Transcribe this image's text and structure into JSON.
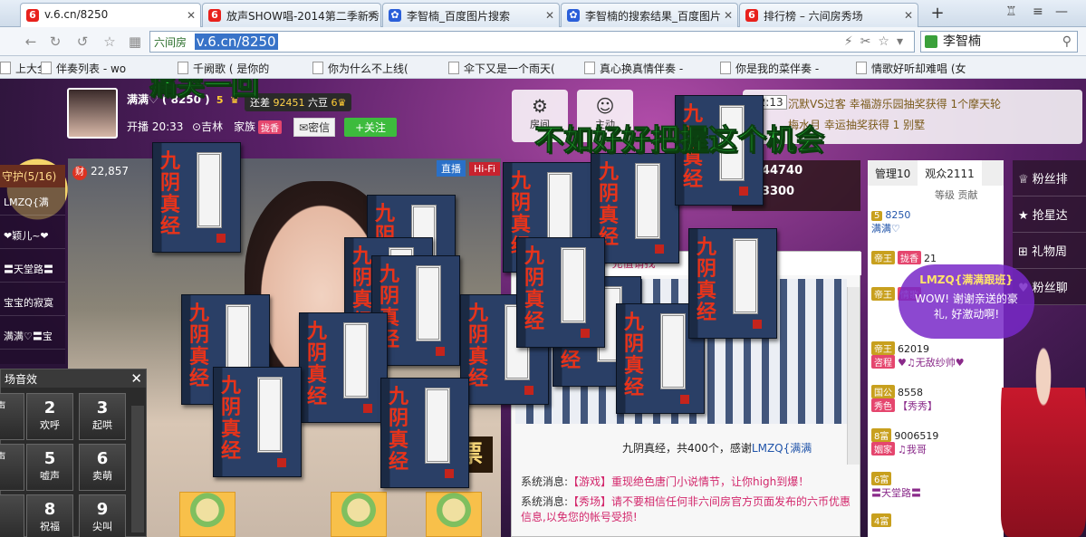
{
  "browser": {
    "tabs": [
      {
        "label": "v.6.cn/8250",
        "fav": "6"
      },
      {
        "label": "放声SHOW唱-2014第二季新秀",
        "fav": "6"
      },
      {
        "label": "李智楠_百度图片搜索",
        "fav": "paw"
      },
      {
        "label": "李智楠的搜索结果_百度图片",
        "fav": "paw"
      },
      {
        "label": "排行榜 – 六间房秀场",
        "fav": "6"
      }
    ],
    "new_tab": "+",
    "address_host": "六间房",
    "address_url": "v.6.cn/8250",
    "search_value": "李智楠",
    "bookmarks": [
      "上大全",
      "伴奏列表 - wo",
      "千阙歌 ( 是你的",
      "你为什么不上线(",
      "伞下又是一个雨天(",
      "真心换真情伴奏 -",
      "你是我的菜伴奏 -",
      "情歌好听却难唱 (女"
    ]
  },
  "header": {
    "host_name": "满满♡ ( 8250 )",
    "level": "5",
    "gap_label": "还差",
    "gap_value": "92451",
    "gap_unit": "六豆",
    "gap_level": "6",
    "open_time": "开播 20:33",
    "location": "吉林",
    "family_label": "家族",
    "family_badge": "拢香",
    "message_button": "密信",
    "follow_button": "+关注",
    "room_buttons": [
      "房间",
      "主动"
    ],
    "ticker_time": "22:13",
    "ticker_line1": "沉默VS过客 幸福游乐园抽奖获得 1个摩天轮",
    "ticker_line2": "梅水月 幸运抽奖获得 1 别墅"
  },
  "guard": {
    "title": "守护(5/16)",
    "items": [
      "LMZQ{满",
      "❤颖儿~❤",
      "〓天堂路〓",
      "宝宝的寂寞",
      "满满♡〓宝"
    ]
  },
  "wealth": {
    "icon": "财",
    "value": "22,857"
  },
  "stream_tags": [
    "直播",
    "Hi-Fi"
  ],
  "vote_label": "票",
  "sound_panel": {
    "title": "场音效",
    "close": "✕",
    "keys": [
      {
        "n": "",
        "l": "声"
      },
      {
        "n": "2",
        "l": "欢呼"
      },
      {
        "n": "3",
        "l": "起哄"
      },
      {
        "n": "",
        "l": "声"
      },
      {
        "n": "5",
        "l": "嘘声"
      },
      {
        "n": "6",
        "l": "卖萌"
      },
      {
        "n": "",
        "l": ""
      },
      {
        "n": "8",
        "l": "祝福"
      },
      {
        "n": "9",
        "l": "尖叫"
      }
    ]
  },
  "stats": {
    "a": "344740",
    "b": "13300"
  },
  "chat": {
    "top_notice": "分认识了你...XX♡ 充值请找",
    "message_prefix": "九阴真经，共400个，感谢",
    "message_user": "LMZQ{满满",
    "sys_label": "系统消息:",
    "sys1": "【游戏】重现绝色唐门小说情节，让你high到爆！",
    "sys2": "【秀场】请不要相信任何非六间房官方页面发布的六币优惠信息,以免您的帐号受损!"
  },
  "viewers": {
    "tab_manage": "管理10",
    "tab_audience": "观众2111",
    "col_level": "等级",
    "col_contrib": "贡献",
    "rows": [
      {
        "lv": "5",
        "tag": "",
        "num": "8250",
        "name": "满满♡"
      },
      {
        "lv": "帝王",
        "tag": "拢香",
        "num": "21",
        "name": ""
      },
      {
        "lv": "帝王",
        "tag": "情歌",
        "num": "",
        "name": ""
      },
      {
        "lv": "帝王",
        "tag": "咨程",
        "num": "62019",
        "name": "♥♫无敌纱帅♥"
      },
      {
        "lv": "国公",
        "tag": "秀色",
        "num": "8558",
        "name": "【秀秀】"
      },
      {
        "lv": "8富",
        "tag": "姻家",
        "num": "9006519",
        "name": "♫我哥"
      },
      {
        "lv": "6富",
        "tag": "",
        "num": "",
        "name": "〓天堂路〓"
      },
      {
        "lv": "4富",
        "tag": "",
        "num": "",
        "name": ""
      }
    ]
  },
  "right_nav": [
    "粉丝排",
    "抢星达",
    "礼物周",
    "粉丝聊"
  ],
  "bubble": {
    "title": "LMZQ{满满跟班}",
    "text": "WOW! 谢谢亲送的豪礼, 好激动啊!"
  },
  "overlay": {
    "line1": "痛哭一回",
    "line2": "不如好好把握这个机会"
  },
  "book_title": "九阴真经"
}
